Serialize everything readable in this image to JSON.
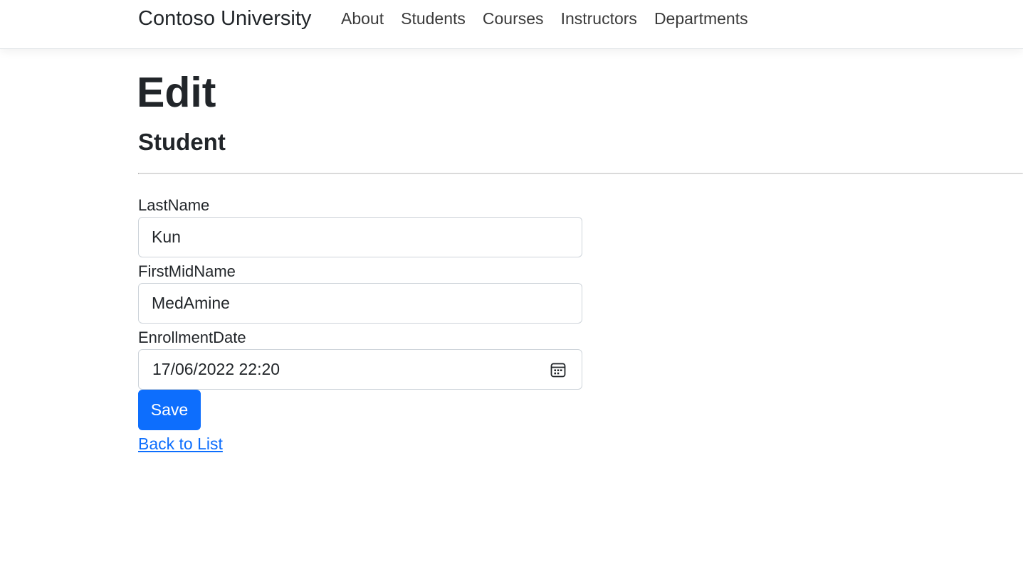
{
  "navbar": {
    "brand": "Contoso University",
    "links": [
      "About",
      "Students",
      "Courses",
      "Instructors",
      "Departments"
    ]
  },
  "page": {
    "title": "Edit",
    "subtitle": "Student"
  },
  "form": {
    "last_name": {
      "label": "LastName",
      "value": "Kun"
    },
    "first_mid_name": {
      "label": "FirstMidName",
      "value": "MedAmine"
    },
    "enrollment_date": {
      "label": "EnrollmentDate",
      "value": "17/06/2022 22:20",
      "icon": "calendar-icon"
    },
    "save_label": "Save"
  },
  "back_link": "Back to List",
  "colors": {
    "primary": "#0d6efd",
    "text": "#212529",
    "border": "#ced4da"
  }
}
